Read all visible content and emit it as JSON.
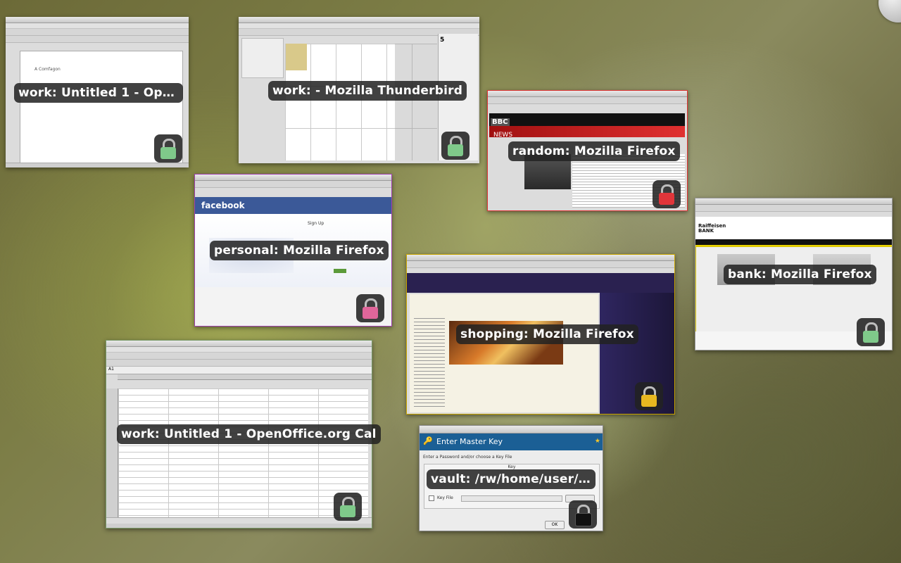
{
  "windows": {
    "writer": {
      "label": "work: Untitled 1 - Open…",
      "doc_text": "A Comfagon",
      "lock_color": "#7fc98a"
    },
    "thunderbird": {
      "label": "work: - Mozilla Thunderbird",
      "lock_color": "#7fc98a",
      "calendar_day": "5"
    },
    "bbc": {
      "label": "random: Mozilla Firefox",
      "lock_color": "#e0353a",
      "logo": "BBC",
      "news": "NEWS"
    },
    "facebook": {
      "label": "personal: Mozilla Firefox",
      "lock_color": "#e0669a",
      "logo": "facebook",
      "signup": "Sign Up"
    },
    "bank": {
      "label": "bank: Mozilla Firefox",
      "lock_color": "#7fc98a",
      "logo_line1": "Raiffeisen",
      "logo_line2": "BANK"
    },
    "shopping": {
      "label": "shopping: Mozilla Firefox",
      "lock_color": "#e8b820"
    },
    "calc": {
      "label": "work: Untitled 1 - OpenOffice.org Cal",
      "lock_color": "#7fc98a",
      "cell_ref": "A1"
    },
    "vault": {
      "label": "vault: /rw/home/user/jo…",
      "lock_color": "#111111",
      "dialog_title": "Enter Master Key",
      "prompt": "Enter a Password and/or choose a Key File",
      "key_header": "Key",
      "keyfile_label": "Key File",
      "ok_label": "OK"
    }
  },
  "colors": {
    "label_bg": "#222222",
    "fb_blue": "#3b5998",
    "bbc_red": "#cc2222",
    "shopping_purple": "#2a2150",
    "vault_blue": "#1b5f95"
  }
}
